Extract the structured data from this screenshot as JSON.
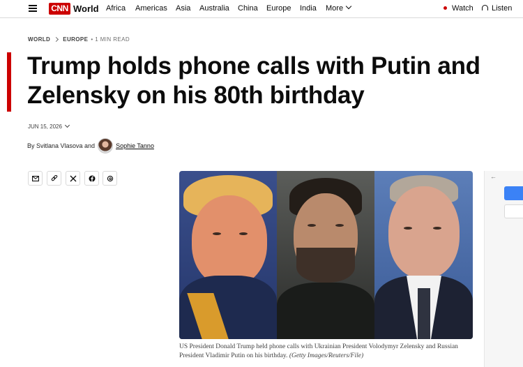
{
  "nav": {
    "logo": "CNN",
    "section": "World",
    "links": [
      "Africa",
      "Americas",
      "Asia",
      "Australia",
      "China",
      "Europe",
      "India"
    ],
    "more_label": "More",
    "watch_label": "Watch",
    "listen_label": "Listen"
  },
  "breadcrumb": {
    "items": [
      "WORLD",
      "EUROPE"
    ],
    "read_time": "• 1 MIN READ"
  },
  "article": {
    "headline": "Trump holds phone calls with Putin and Zelensky on his 80th birthday",
    "date": "JUN 15, 2026",
    "byline_prefix": "By Svitlana Vlasova and",
    "second_author": "Sophie Tanno",
    "caption": "US President Donald Trump held phone calls with Ukrainian President Volodymyr Zelensky and Russian President Vladimir Putin on his birthday.",
    "caption_credit": "(Getty Images/Reuters/File)"
  },
  "share_buttons": [
    "email-icon",
    "link-icon",
    "x-icon",
    "facebook-icon",
    "threads-icon"
  ],
  "rail": {
    "arrow": "←"
  },
  "colors": {
    "brand_red": "#cc0000",
    "rail_button_blue": "#3b82f6"
  }
}
